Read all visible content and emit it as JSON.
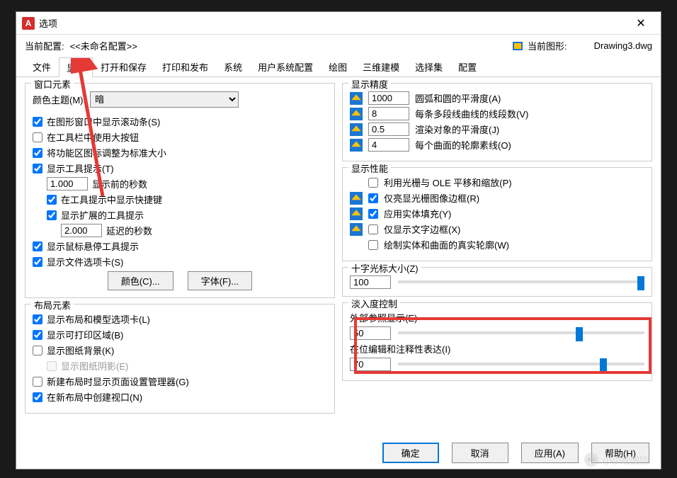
{
  "titlebar": {
    "app_icon": "A",
    "title": "选项",
    "close": "✕"
  },
  "info": {
    "profile_label": "当前配置:",
    "profile_value": "<<未命名配置>>",
    "drawing_label": "当前图形:",
    "drawing_value": "Drawing3.dwg"
  },
  "tabs": [
    "文件",
    "显示",
    "打开和保存",
    "打印和发布",
    "系统",
    "用户系统配置",
    "绘图",
    "三维建模",
    "选择集",
    "配置"
  ],
  "active_tab": 1,
  "window_elements": {
    "title": "窗口元素",
    "theme_label": "颜色主题(M):",
    "theme_value": "暗",
    "cb_scrollbars": "在图形窗口中显示滚动条(S)",
    "cb_bigbuttons": "在工具栏中使用大按钮",
    "cb_resize_icons": "将功能区图标调整为标准大小",
    "cb_tooltips": "显示工具提示(T)",
    "seconds_before": "1.000",
    "seconds_before_label": "显示前的秒数",
    "cb_shortcut_in_tip": "在工具提示中显示快捷键",
    "cb_extended_tip": "显示扩展的工具提示",
    "delay_seconds": "2.000",
    "delay_label": "延迟的秒数",
    "cb_hover_tip": "显示鼠标悬停工具提示",
    "cb_file_tabs": "显示文件选项卡(S)",
    "btn_color": "颜色(C)...",
    "btn_font": "字体(F)..."
  },
  "layout_elements": {
    "title": "布局元素",
    "cb_layout_tabs": "显示布局和模型选项卡(L)",
    "cb_printable": "显示可打印区域(B)",
    "cb_paper_bg": "显示图纸背景(K)",
    "cb_paper_shadow": "显示图纸阴影(E)",
    "cb_page_setup": "新建布局时显示页面设置管理器(G)",
    "cb_new_viewport": "在新布局中创建视口(N)"
  },
  "precision": {
    "title": "显示精度",
    "arc_val": "1000",
    "arc_label": "圆弧和圆的平滑度(A)",
    "seg_val": "8",
    "seg_label": "每条多段线曲线的线段数(V)",
    "render_val": "0.5",
    "render_label": "渲染对象的平滑度(J)",
    "surf_val": "4",
    "surf_label": "每个曲面的轮廓素线(O)"
  },
  "performance": {
    "title": "显示性能",
    "cb_raster_ole": "利用光栅与 OLE 平移和缩放(P)",
    "cb_highlight_raster": "仅亮显光栅图像边框(R)",
    "cb_solid_fill": "应用实体填充(Y)",
    "cb_text_frame": "仅显示文字边框(X)",
    "cb_true_silhouette": "绘制实体和曲面的真实轮廓(W)"
  },
  "crosshair": {
    "title": "十字光标大小(Z)",
    "value": "100"
  },
  "fade": {
    "title": "淡入度控制",
    "xref_label": "外部参照显示(E)",
    "xref_value": "50",
    "inplace_label": "在位编辑和注释性表达(I)",
    "inplace_value": "70"
  },
  "footer": {
    "ok": "确定",
    "cancel": "取消",
    "apply": "应用(A)",
    "help": "帮助(H)"
  },
  "watermark": "小小绘图院"
}
